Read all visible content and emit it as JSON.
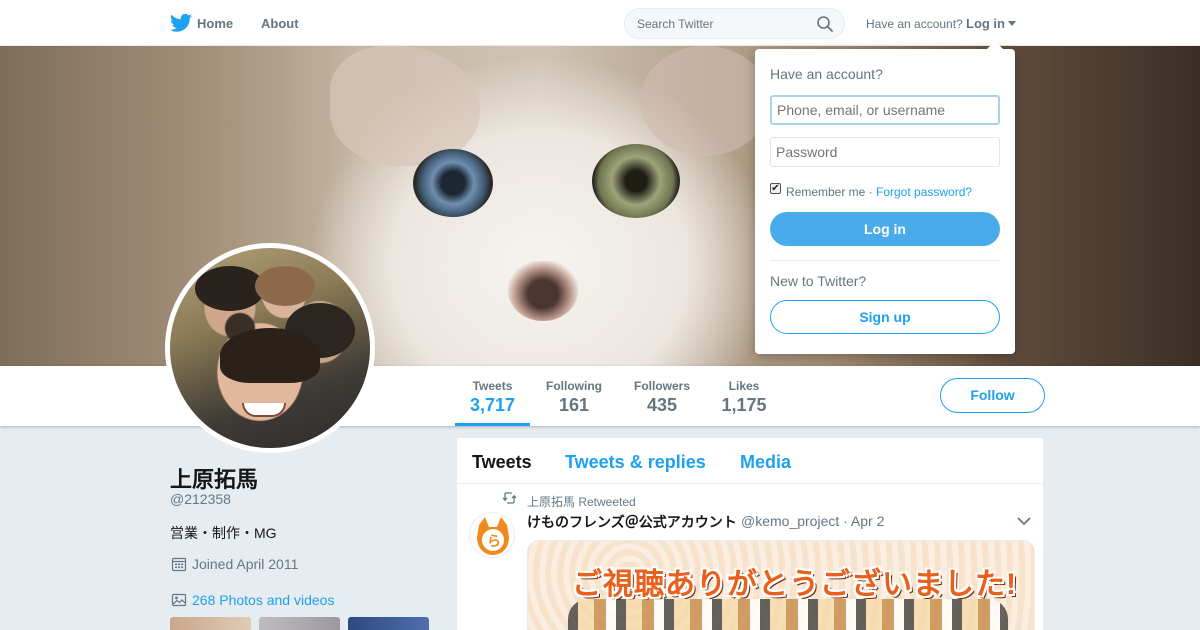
{
  "nav": {
    "home_label": "Home",
    "about_label": "About",
    "search_placeholder": "Search Twitter",
    "have_account": "Have an account?",
    "login_label": "Log in"
  },
  "login_dropdown": {
    "title": "Have an account?",
    "username_placeholder": "Phone, email, or username",
    "password_placeholder": "Password",
    "remember_label": "Remember me ·",
    "forgot_label": "Forgot password?",
    "login_button": "Log in",
    "new_label": "New to Twitter?",
    "signup_button": "Sign up"
  },
  "profile": {
    "name": "上原拓馬",
    "handle": "@212358",
    "bio": "営業・制作・MG",
    "joined": "Joined April 2011",
    "photos": "268 Photos and videos"
  },
  "stats": [
    {
      "label": "Tweets",
      "value": "3,717"
    },
    {
      "label": "Following",
      "value": "161"
    },
    {
      "label": "Followers",
      "value": "435"
    },
    {
      "label": "Likes",
      "value": "1,175"
    }
  ],
  "follow_button": "Follow",
  "timeline": {
    "tabs": [
      "Tweets",
      "Tweets & replies",
      "Media"
    ],
    "tweet": {
      "retweeted_by": "上原拓馬 Retweeted",
      "author": "けものフレンズ＠公式アカウント",
      "meta": "@kemo_project · Apr 2",
      "media_text": "ご視聴ありがとうございました!"
    }
  },
  "colors": {
    "accent": "#1da1f2",
    "login_button": "#4aabea",
    "page_bg": "#e6ecf0"
  }
}
